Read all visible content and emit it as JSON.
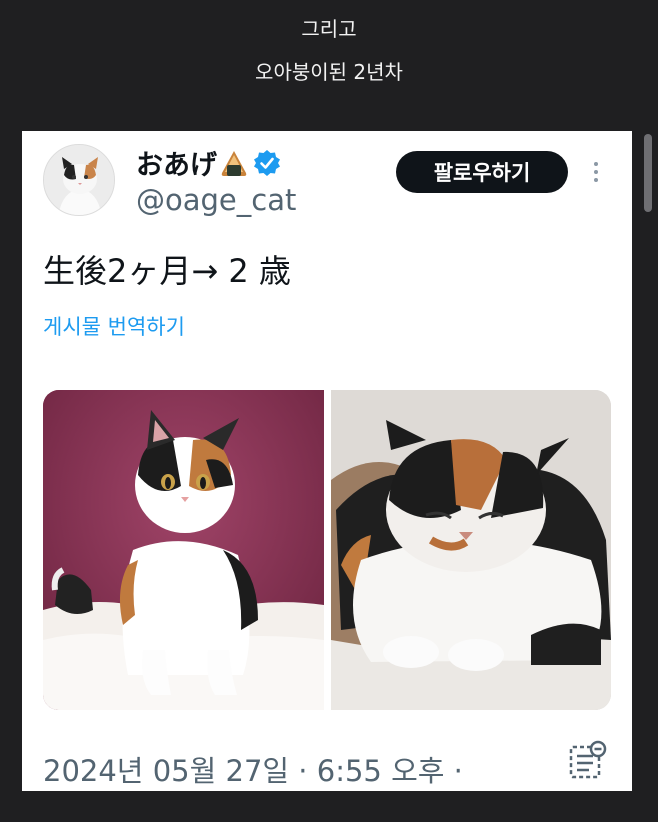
{
  "caption": {
    "line1": "그리고",
    "line2": "오아붕이된 2년차"
  },
  "tweet": {
    "display_name": "おあげ",
    "handle": "@oage_cat",
    "follow_label": "팔로우하기",
    "text": "生後2ヶ月→ 2 歳",
    "translate_label": "게시물 번역하기",
    "timestamp": "2024년 05월 27일 · 6:55 오후 ·",
    "photos": [
      {
        "name": "kitten-photo",
        "subject": "calico kitten"
      },
      {
        "name": "adult-cat-photo",
        "subject": "calico adult cat"
      }
    ]
  },
  "icons": {
    "name_emoji": "onigiri-emoji-icon",
    "verified": "verified-badge-icon",
    "more": "more-options-icon",
    "notes": "notes-icon"
  },
  "colors": {
    "background": "#1f1f21",
    "card": "#ffffff",
    "verified_blue": "#1d9bf0",
    "link_blue": "#1d9bf0",
    "follow_button": "#0f1419",
    "muted_text": "#536471"
  }
}
